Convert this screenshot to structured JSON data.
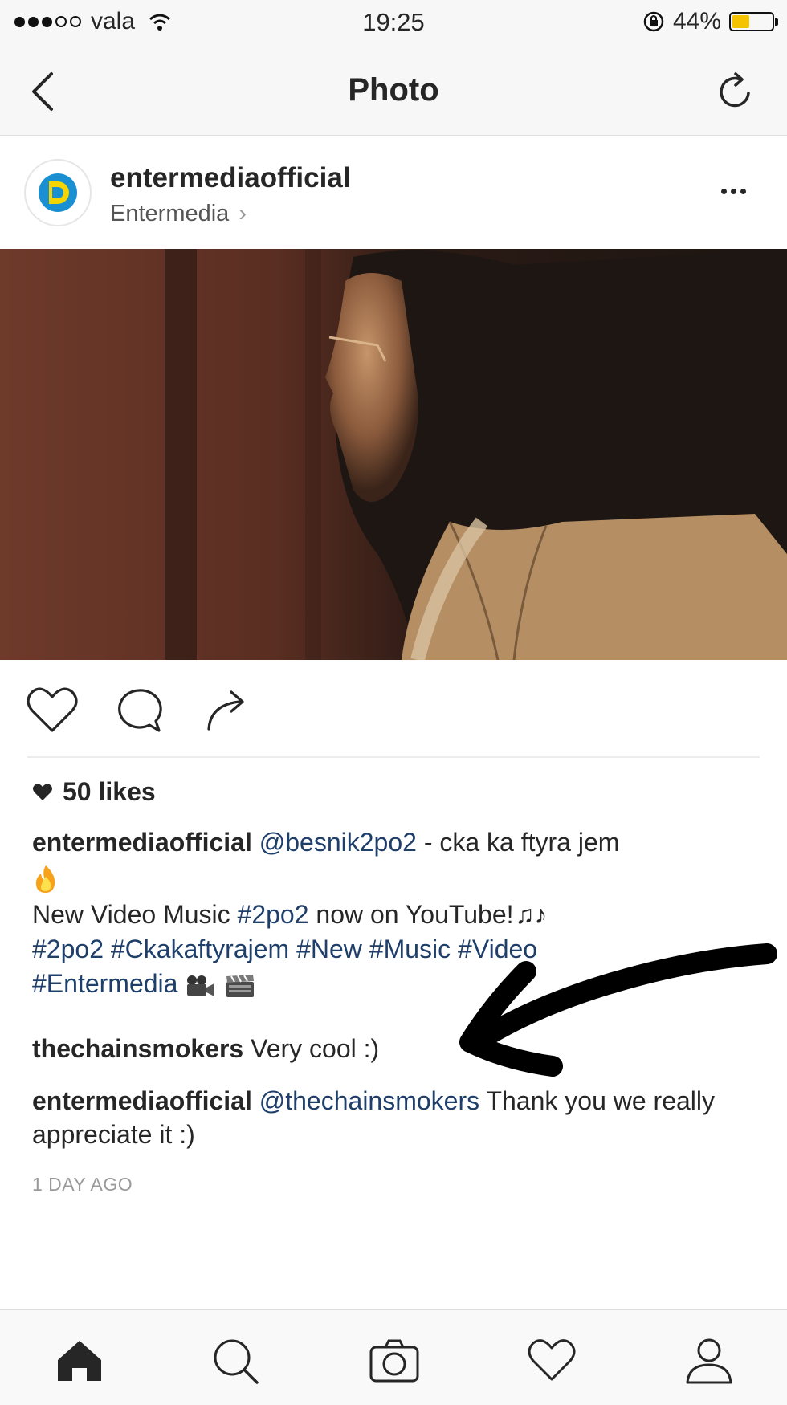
{
  "status_bar": {
    "carrier": "vala",
    "time": "19:25",
    "battery_percent": "44%",
    "battery_level": 0.44,
    "icons": [
      "signal-dots-icon",
      "wifi-icon",
      "rotation-lock-icon",
      "battery-icon"
    ]
  },
  "nav": {
    "title": "Photo",
    "back_icon": "chevron-left-icon",
    "refresh_icon": "refresh-icon"
  },
  "post": {
    "username": "entermediaofficial",
    "location": "Entermedia",
    "location_chevron": "›",
    "more_icon": "ellipsis-icon",
    "likes": "50 likes",
    "caption": {
      "username": "entermediaofficial",
      "mention": "@besnik2po2",
      "text1": " - cka ka ftyra jem",
      "line2_pre": "New Video Music ",
      "line2_tag": "#2po2",
      "line2_post": " now on YouTube!",
      "hashtags": "#2po2 #Ckakaftyrajem #New #Music #Video",
      "hashtags2": "#Entermedia"
    },
    "comments": [
      {
        "username": "thechainsmokers",
        "text": " Very cool :)"
      },
      {
        "username": "entermediaofficial",
        "mention": "@thechainsmokers",
        "text": " Thank you we really appreciate it :)"
      }
    ],
    "timestamp": "1 DAY AGO"
  },
  "tab_bar": {
    "items": [
      "home-icon",
      "search-icon",
      "camera-icon",
      "heart-icon",
      "profile-icon"
    ],
    "active": "home-icon"
  },
  "colors": {
    "link": "#1f3f6b",
    "battery": "#f6c300",
    "avatar_blue": "#1a8fd1",
    "avatar_yellow": "#f5d400"
  }
}
